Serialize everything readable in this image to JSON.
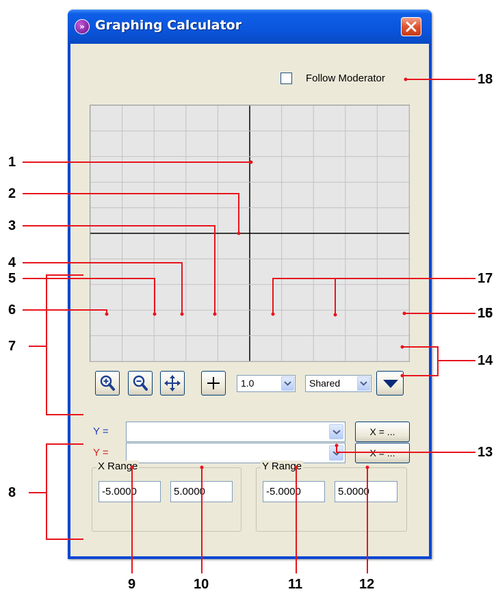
{
  "window": {
    "title": "Graphing Calculator",
    "app_icon": "»"
  },
  "follow_moderator": {
    "label": "Follow Moderator",
    "checked": false
  },
  "toolbar": {
    "zoom_in_icon": "zoom-in-magnifier-icon",
    "zoom_out_icon": "zoom-out-magnifier-icon",
    "pan_icon": "four-way-arrows-icon",
    "crosshair_icon": "crosshair-icon",
    "scale_value": "1.0",
    "mode_value": "Shared",
    "menu_icon": "triangle-down-icon"
  },
  "equations": [
    {
      "label": "Y =",
      "value": "",
      "color": "#1f3fbf",
      "x_button": "X = ..."
    },
    {
      "label": "Y =",
      "value": "",
      "color": "#d42020",
      "x_button": "X = ..."
    }
  ],
  "x_range": {
    "label": "X Range",
    "min": "-5.0000",
    "max": "5.0000"
  },
  "y_range": {
    "label": "Y Range",
    "min": "-5.0000",
    "max": "5.0000"
  },
  "callouts": [
    "1",
    "2",
    "3",
    "4",
    "5",
    "6",
    "7",
    "8",
    "9",
    "10",
    "11",
    "12",
    "13",
    "14",
    "15",
    "16",
    "17",
    "18"
  ],
  "colors": {
    "callout_line": "#e8141c",
    "title_bar": "#0a55dc",
    "client_bg": "#ece9d8"
  }
}
